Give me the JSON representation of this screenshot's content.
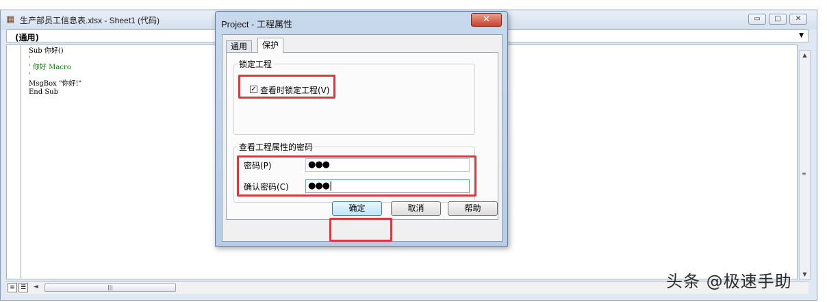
{
  "code_window": {
    "title": "生产部员工信息表.xlsx - Sheet1 (代码)",
    "object_dropdown": "(通用)",
    "code_lines": [
      "Sub 你好()",
      "'",
      "' 你好 Macro",
      "'",
      "MsgBox \"你好!\"",
      "End Sub"
    ],
    "buttons": {
      "minimize": "▭",
      "maximize": "□",
      "close": "✕"
    }
  },
  "dialog": {
    "title": "Project - 工程属性",
    "close": "✕",
    "tabs": [
      {
        "label": "通用"
      },
      {
        "label": "保护"
      }
    ],
    "lock_group": {
      "title": "锁定工程",
      "checkbox_label": "查看时锁定工程(V)",
      "checked": true
    },
    "password_group": {
      "title": "查看工程属性的密码",
      "password_label": "密码(P)",
      "password_value": "●●●",
      "confirm_label": "确认密码(C)",
      "confirm_value": "●●●|"
    },
    "buttons": {
      "ok": "确定",
      "cancel": "取消",
      "help": "帮助"
    }
  },
  "watermark": "头条 @极速手助",
  "colors": {
    "highlight": "#e0363a",
    "title_gradient": "#c9d9ec",
    "code_green": "#007f00"
  }
}
